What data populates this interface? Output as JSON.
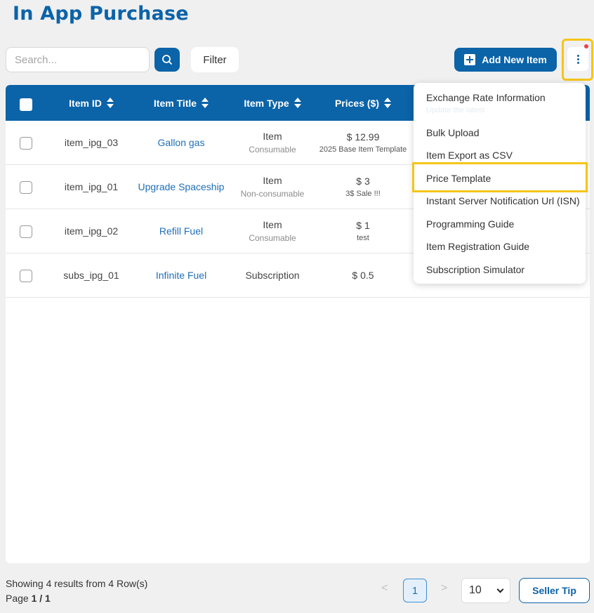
{
  "header": {
    "title": "In App Purchase"
  },
  "toolbar": {
    "search_placeholder": "Search...",
    "filter_label": "Filter",
    "add_label": "Add New Item"
  },
  "table": {
    "columns": [
      "Item ID",
      "Item Title",
      "Item Type",
      "Prices ($)"
    ],
    "rows": [
      {
        "id": "item_ipg_03",
        "title": "Gallon gas",
        "type": "Item",
        "type_sub": "Consumable",
        "price": "$ 12.99",
        "price_sub": "2025 Base Item Template"
      },
      {
        "id": "item_ipg_01",
        "title": "Upgrade Spaceship",
        "type": "Item",
        "type_sub": "Non-consumable",
        "price": "$ 3",
        "price_sub": "3$ Sale !!!"
      },
      {
        "id": "item_ipg_02",
        "title": "Refill Fuel",
        "type": "Item",
        "type_sub": "Consumable",
        "price": "$ 1",
        "price_sub": "test"
      },
      {
        "id": "subs_ipg_01",
        "title": "Infinite Fuel",
        "type": "Subscription",
        "type_sub": "",
        "price": "$ 0.5",
        "price_sub": ""
      }
    ]
  },
  "menu": {
    "items": [
      "Exchange Rate Information",
      "Bulk Upload",
      "Item Export as CSV",
      "Price Template",
      "Instant Server Notification Url (ISN)",
      "Programming Guide",
      "Item Registration Guide",
      "Subscription Simulator"
    ],
    "exchange_sub": "Update the latest"
  },
  "footer": {
    "showing": "Showing 4 results from 4 Row(s)",
    "page_label": "Page",
    "page_value": "1 / 1",
    "prev": "<",
    "next": ">",
    "current_page": "1",
    "per_page": "10",
    "seller_tip": "Seller Tip"
  },
  "colors": {
    "primary": "#0b63a8",
    "highlight": "#f5c518",
    "notification": "#e8424c"
  }
}
